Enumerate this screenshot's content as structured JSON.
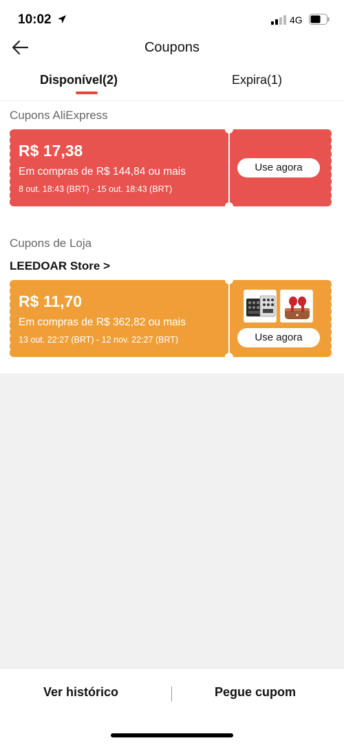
{
  "status_bar": {
    "time": "10:02",
    "network": "4G"
  },
  "header": {
    "title": "Coupons"
  },
  "tabs": [
    {
      "label": "Disponível(2)",
      "active": true
    },
    {
      "label": "Expira(1)",
      "active": false
    }
  ],
  "sections": {
    "platform": {
      "label": "Cupons AliExpress"
    },
    "store": {
      "label": "Cupons de Loja",
      "store_name": "LEEDOAR Store >"
    }
  },
  "coupons": [
    {
      "value": "R$ 17,38",
      "condition": "Em compras de R$ 144,84 ou mais",
      "dates": "8 out. 18:43 (BRT) - 15 out. 18:43 (BRT)",
      "button": "Use agora",
      "color": "#e8524f"
    },
    {
      "value": "R$ 11,70",
      "condition": "Em compras de R$ 362,82 ou mais",
      "dates": "13 out. 22:27 (BRT) - 12 nov. 22:27 (BRT)",
      "button": "Use agora",
      "color": "#f09f38",
      "thumbnails": [
        "audio-mixer-thumbnail",
        "red-earbuds-thumbnail"
      ]
    }
  ],
  "bottom_bar": {
    "history": "Ver histórico",
    "get_coupon": "Pegue cupom"
  },
  "colors": {
    "accent": "#e8453c"
  }
}
